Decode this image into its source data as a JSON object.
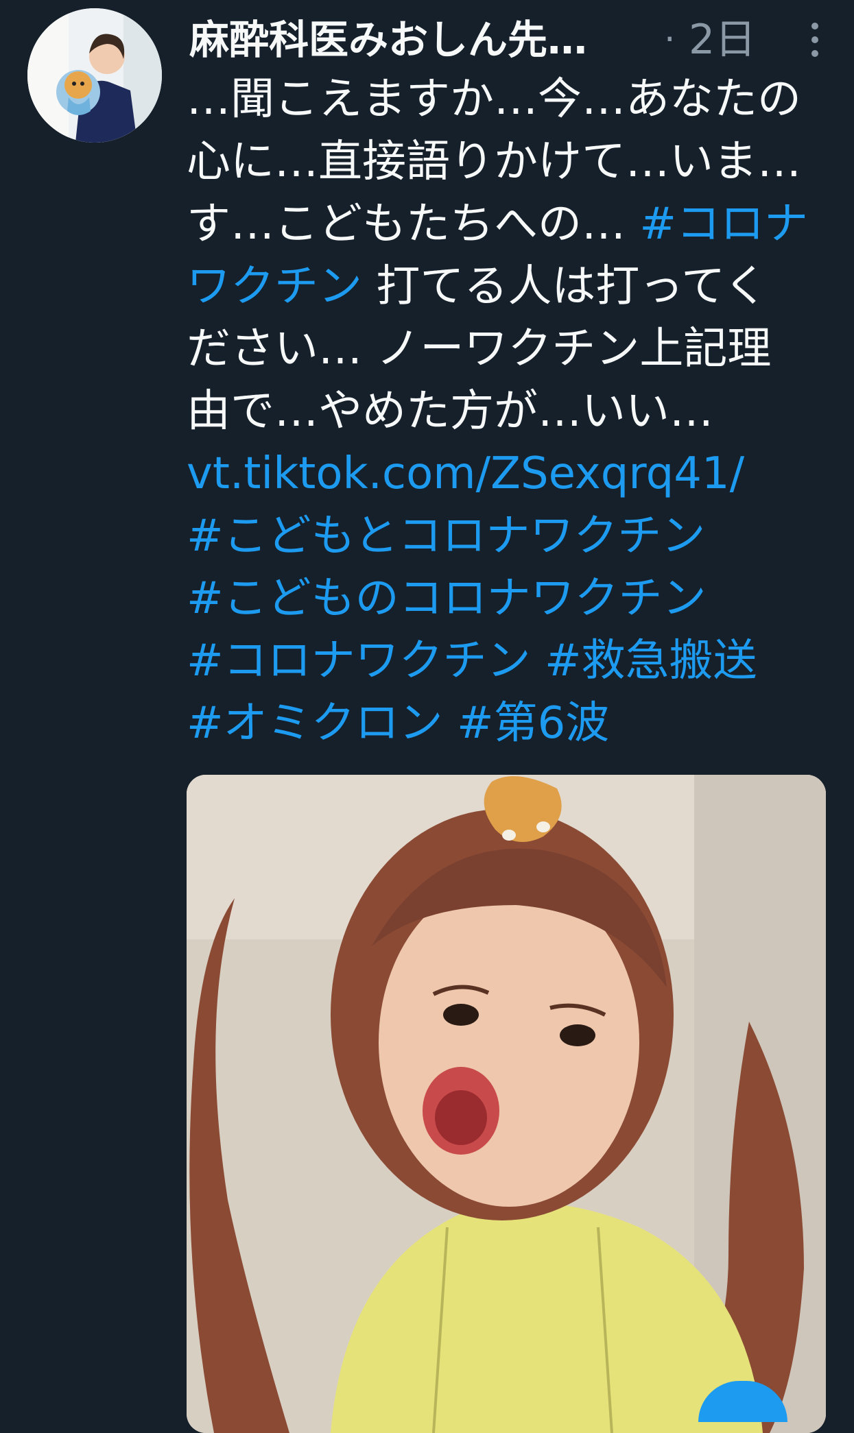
{
  "tweet": {
    "author_name": "麻酔科医みおしん先…",
    "separator": "·",
    "timestamp": "2日",
    "more_icon": "more-vertical-icon",
    "text_lines": [
      [
        {
          "t": "…聞こえますか…今…あなたの",
          "k": "text"
        }
      ],
      [
        {
          "t": "心に…直接語りかけて…いま…",
          "k": "text"
        }
      ],
      [
        {
          "t": "す…こどもたちへの… ",
          "k": "text"
        },
        {
          "t": "#コロナ",
          "k": "tag"
        }
      ],
      [
        {
          "t": "ワクチン",
          "k": "tag"
        },
        {
          "t": " 打てる人は打ってく",
          "k": "text"
        }
      ],
      [
        {
          "t": "ださい… ノーワクチン上記理",
          "k": "text"
        }
      ],
      [
        {
          "t": "由で…やめた方が…いい…",
          "k": "text"
        }
      ],
      [
        {
          "t": "vt.tiktok.com/ZSexqrq41/",
          "k": "link"
        }
      ],
      [
        {
          "t": "#こどもとコロナワクチン",
          "k": "tag"
        }
      ],
      [
        {
          "t": "#こどものコロナワクチン",
          "k": "tag"
        }
      ],
      [
        {
          "t": "#コロナワクチン",
          "k": "tag"
        },
        {
          "t": " ",
          "k": "text"
        },
        {
          "t": "#救急搬送",
          "k": "tag"
        }
      ],
      [
        {
          "t": "#オミクロン",
          "k": "tag"
        },
        {
          "t": " ",
          "k": "text"
        },
        {
          "t": "#第6波",
          "k": "tag"
        }
      ]
    ],
    "colors": {
      "background": "#15202b",
      "text": "#f7f9f9",
      "secondary": "#8b98a5",
      "link": "#1d9bf0"
    }
  }
}
